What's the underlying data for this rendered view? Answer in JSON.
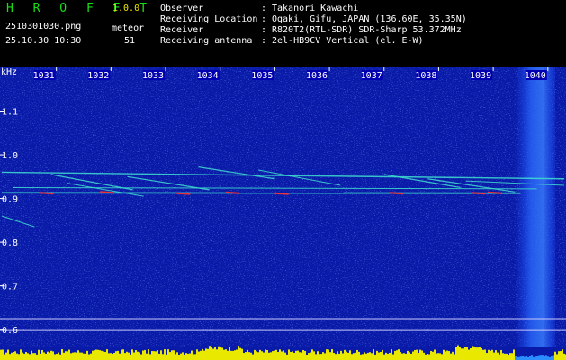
{
  "header": {
    "app_title": "H R O F F T",
    "version": "1.0.0",
    "filename": "2510301030.png",
    "meteor_label": "meteor",
    "meteor_count": "51",
    "datetime": "25.10.30 10:30",
    "info": [
      {
        "label": "Observer",
        "value": "Takanori Kawachi"
      },
      {
        "label": "Receiving Location",
        "value": "Ogaki, Gifu, JAPAN (136.60E, 35.35N)"
      },
      {
        "label": "Receiver",
        "value": "R820T2(RTL-SDR) SDR-Sharp 53.372MHz"
      },
      {
        "label": "Receiving antenna",
        "value": "2el-HB9CV Vertical (el. E-W)"
      }
    ]
  },
  "spectrogram": {
    "y_unit": "kHz",
    "y_ticks": [
      "1.1",
      "1.0",
      "0.9",
      "0.8",
      "0.7",
      "0.6"
    ],
    "y_values": [
      1.1,
      1.0,
      0.9,
      0.8,
      0.7,
      0.6
    ],
    "y_range": [
      0.59,
      1.2
    ],
    "time_ticks": [
      "1031",
      "1032",
      "1033",
      "1034",
      "1035",
      "1036",
      "1037",
      "1038",
      "1039",
      "1040"
    ],
    "time_range_minutes": [
      1030,
      1040.3
    ],
    "colors": {
      "background": "#0a1aa8",
      "text": "#ffffff",
      "title": "#18e018",
      "version": "#e8e800",
      "tick_label_bg": "#0000b0",
      "audio_level": "#e8e800",
      "reference_line": "#c8c8ff",
      "trace": "#40e0d0",
      "trace_hot": "#ff3030"
    }
  }
}
